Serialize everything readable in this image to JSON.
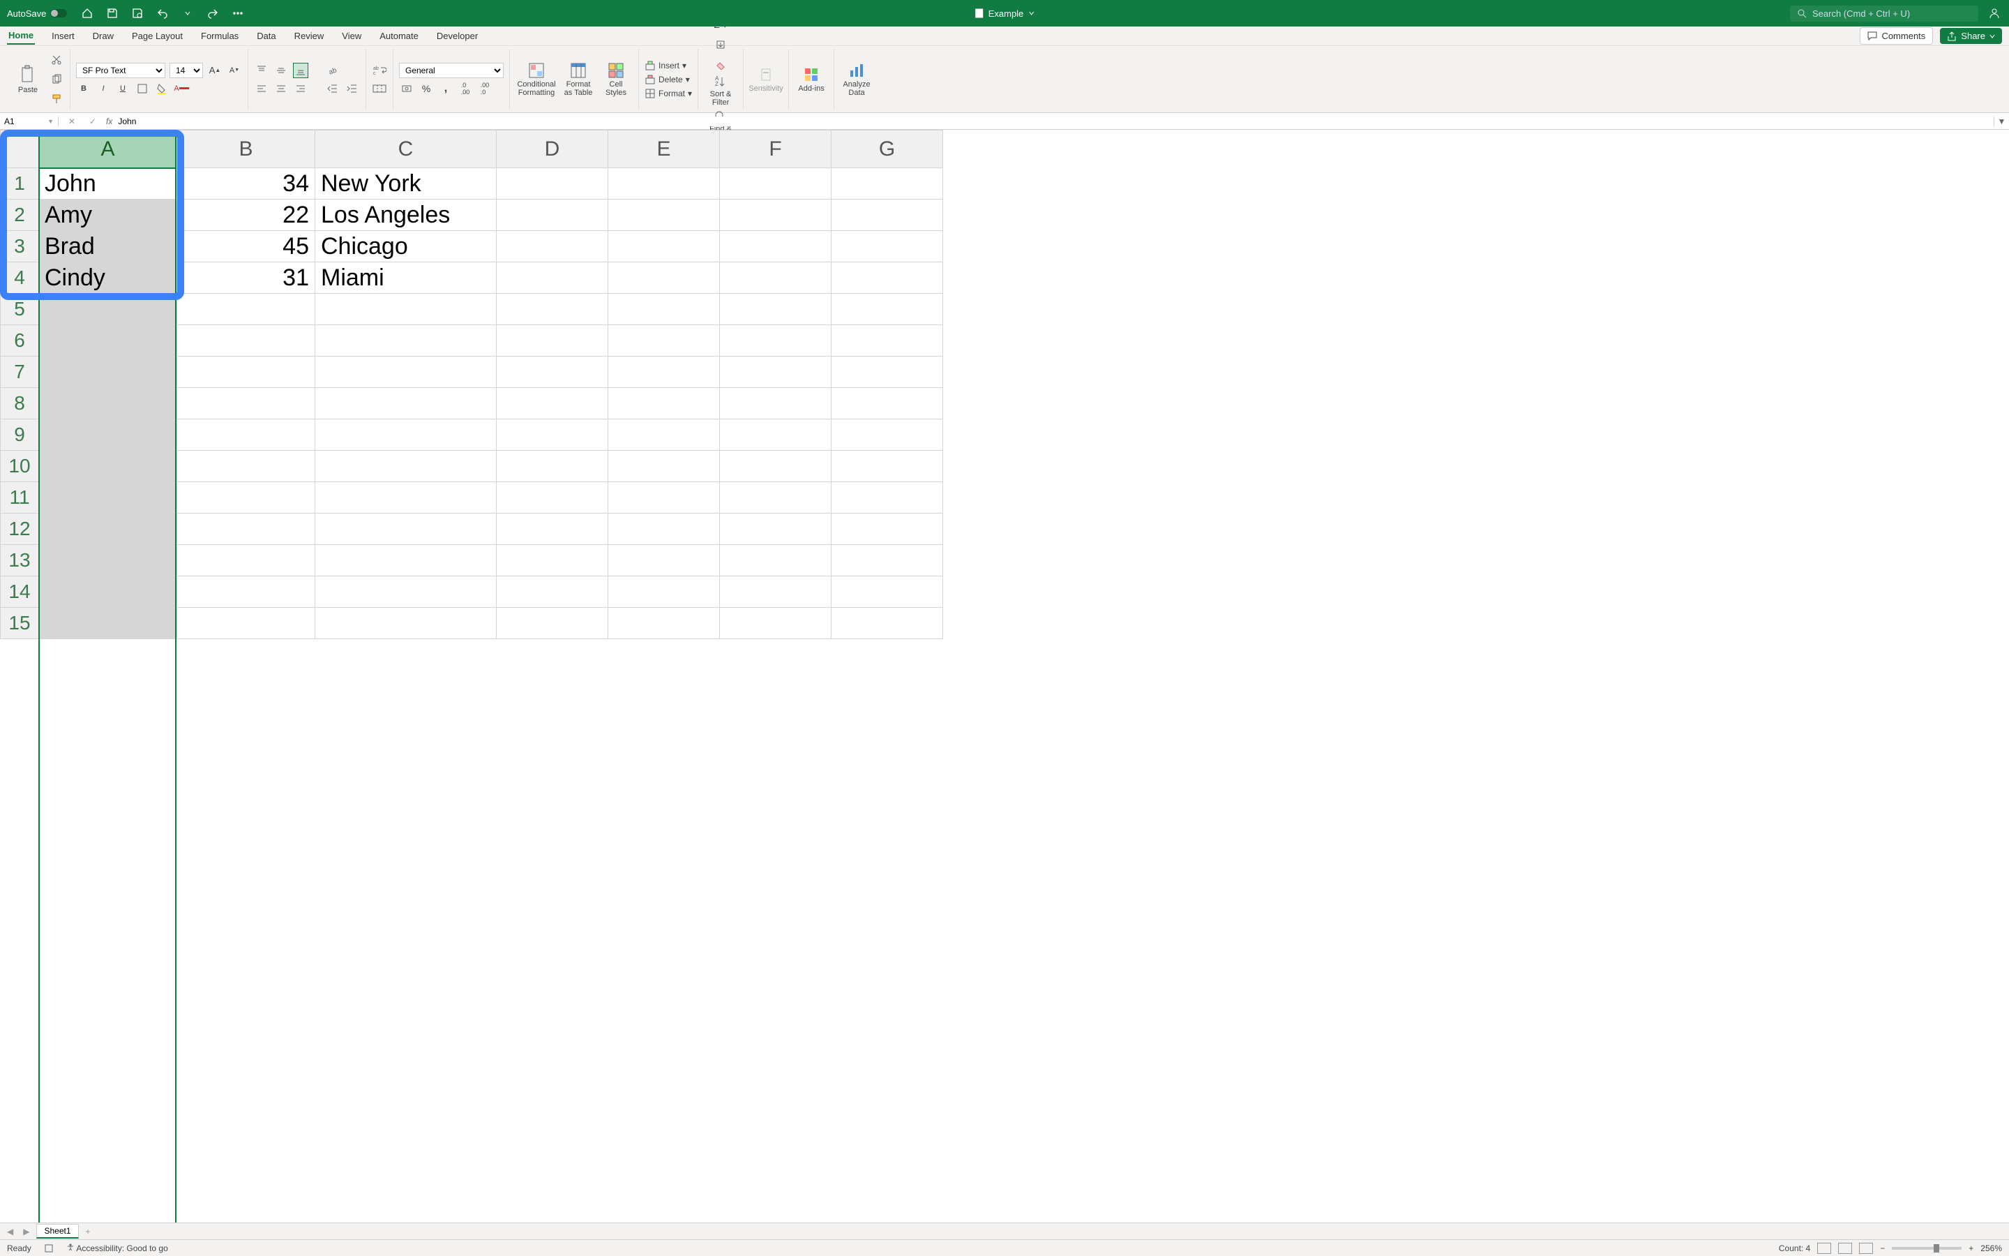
{
  "titlebar": {
    "autosave_label": "AutoSave",
    "doc_name": "Example",
    "search_placeholder": "Search (Cmd + Ctrl + U)"
  },
  "tabs": {
    "items": [
      "Home",
      "Insert",
      "Draw",
      "Page Layout",
      "Formulas",
      "Data",
      "Review",
      "View",
      "Automate",
      "Developer"
    ],
    "active": "Home",
    "comments": "Comments",
    "share": "Share"
  },
  "ribbon": {
    "paste": "Paste",
    "font_name": "SF Pro Text",
    "font_size": "14",
    "number_format": "General",
    "conditional_formatting": "Conditional Formatting",
    "format_as_table": "Format as Table",
    "cell_styles": "Cell Styles",
    "insert": "Insert",
    "delete": "Delete",
    "format": "Format",
    "sort_filter": "Sort & Filter",
    "find_select": "Find & Select",
    "sensitivity": "Sensitivity",
    "addins": "Add-ins",
    "analyze_data": "Analyze Data"
  },
  "formula_bar": {
    "name_box": "A1",
    "fx": "fx",
    "formula": "John"
  },
  "grid": {
    "columns": [
      "A",
      "B",
      "C",
      "D",
      "E",
      "F",
      "G"
    ],
    "row_count": 15,
    "selected_column": "A",
    "active_cell": "A1",
    "data": [
      {
        "A": "John",
        "B": "34",
        "C": "New York"
      },
      {
        "A": "Amy",
        "B": "22",
        "C": "Los Angeles"
      },
      {
        "A": "Brad",
        "B": "45",
        "C": "Chicago"
      },
      {
        "A": "Cindy",
        "B": "31",
        "C": "Miami"
      }
    ]
  },
  "sheet_tabs": {
    "active": "Sheet1"
  },
  "status_bar": {
    "ready": "Ready",
    "accessibility": "Accessibility: Good to go",
    "count_label": "Count: 4",
    "zoom": "256%"
  }
}
